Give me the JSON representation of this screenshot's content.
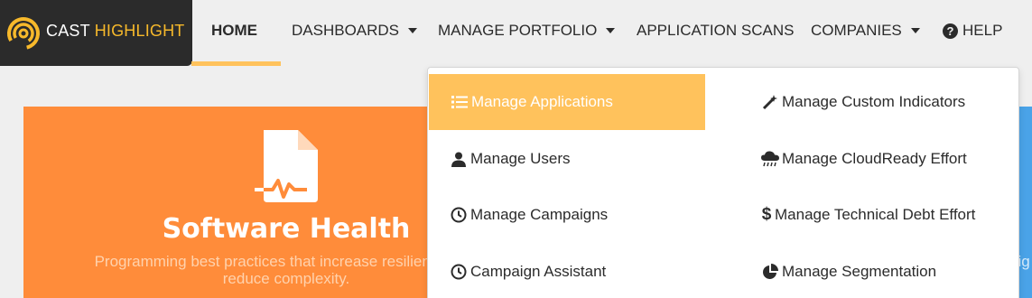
{
  "brand": {
    "name_part1": "CAST",
    "name_part2": "HIGHLIGHT",
    "logo_icon": "cast-logo-icon"
  },
  "nav": {
    "home": "HOME",
    "dashboards": "DASHBOARDS",
    "manage_portfolio": "MANAGE PORTFOLIO",
    "application_scans": "APPLICATION SCANS",
    "companies": "COMPANIES",
    "help": "HELP"
  },
  "dropdown": {
    "left": [
      {
        "label": "Manage Applications",
        "icon": "tasks-icon",
        "highlighted": true
      },
      {
        "label": "Manage Users",
        "icon": "user-icon"
      },
      {
        "label": "Manage Campaigns",
        "icon": "clock-icon"
      },
      {
        "label": "Campaign Assistant",
        "icon": "clock-icon"
      }
    ],
    "right": [
      {
        "label": "Manage Custom Indicators",
        "icon": "magic-wand-icon"
      },
      {
        "label": "Manage CloudReady Effort",
        "icon": "cloud-rain-icon"
      },
      {
        "label": "Manage Technical Debt Effort",
        "icon": "dollar-icon"
      },
      {
        "label": "Manage Segmentation",
        "icon": "pie-chart-icon"
      }
    ]
  },
  "card": {
    "title": "Software Health",
    "description_line1": "Programming best practices that increase resiliency, imp",
    "description_line2": "reduce complexity.",
    "icon": "file-health-icon"
  },
  "blue_card": {
    "text_fragment": "hig"
  },
  "colors": {
    "accent": "#ffc25c",
    "orange_card": "#ff8c3a",
    "brand_yellow": "#f7b92b",
    "dark": "#2b2b2b",
    "blue_card": "#4aa3e8"
  }
}
